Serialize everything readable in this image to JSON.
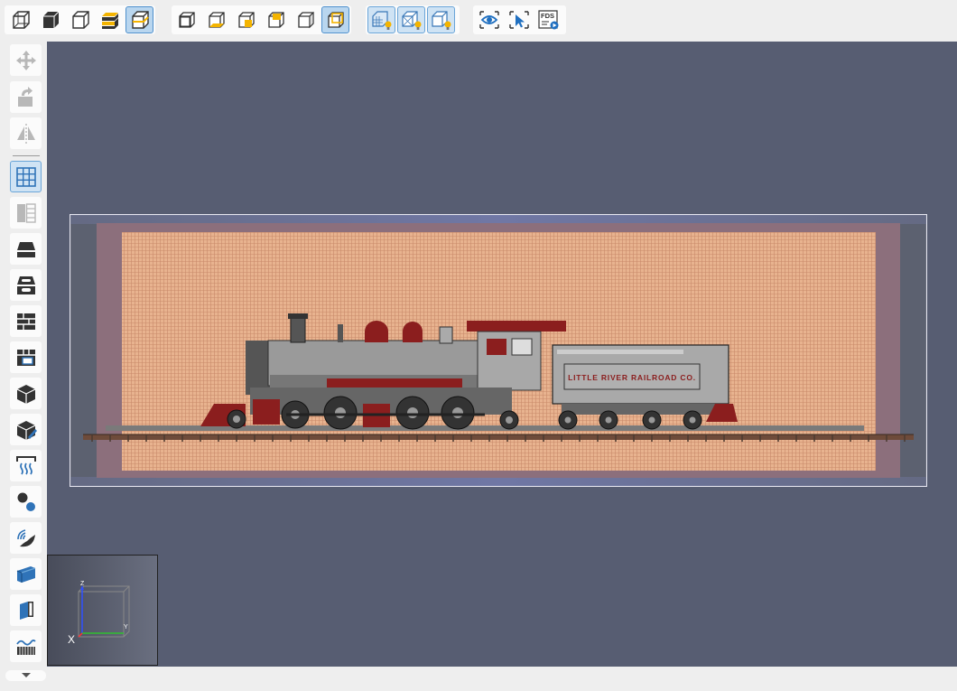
{
  "app": {
    "accent_color": "#4f90cc",
    "viewport_bg": "#575d72"
  },
  "toolbar_top": {
    "view_mode_group": [
      "cube-wireframe-icon",
      "cube-solid-icon",
      "cube-outline-icon",
      "layers-icon",
      "cube-shaded-icon"
    ],
    "camera_group": [
      "view-front-icon",
      "view-bottom-icon",
      "view-right-icon",
      "view-top-icon",
      "view-left-icon",
      "view-back-icon"
    ],
    "lighting_group": [
      "light-grid-icon",
      "light-wireframe-icon",
      "light-solid-icon"
    ],
    "tools_group": [
      "eye-icon",
      "select-cursor-icon"
    ],
    "fds_label": "FDS"
  },
  "toolbar_left": {
    "items": [
      "move-icon",
      "rotate-icon",
      "mirror-icon",
      "grid-icon",
      "panel-icon",
      "slab-icon",
      "hole-icon",
      "wall-icon",
      "window-icon",
      "box-icon",
      "cube-edit-icon",
      "heat-icon",
      "particles-icon",
      "fan-icon",
      "surface-icon",
      "door-icon",
      "terrain-icon"
    ]
  },
  "viewport": {
    "tender_lettering": "LITTLE RIVER RAILROAD CO.",
    "axes": {
      "x": "X",
      "y": "Y",
      "z": "Z"
    }
  }
}
